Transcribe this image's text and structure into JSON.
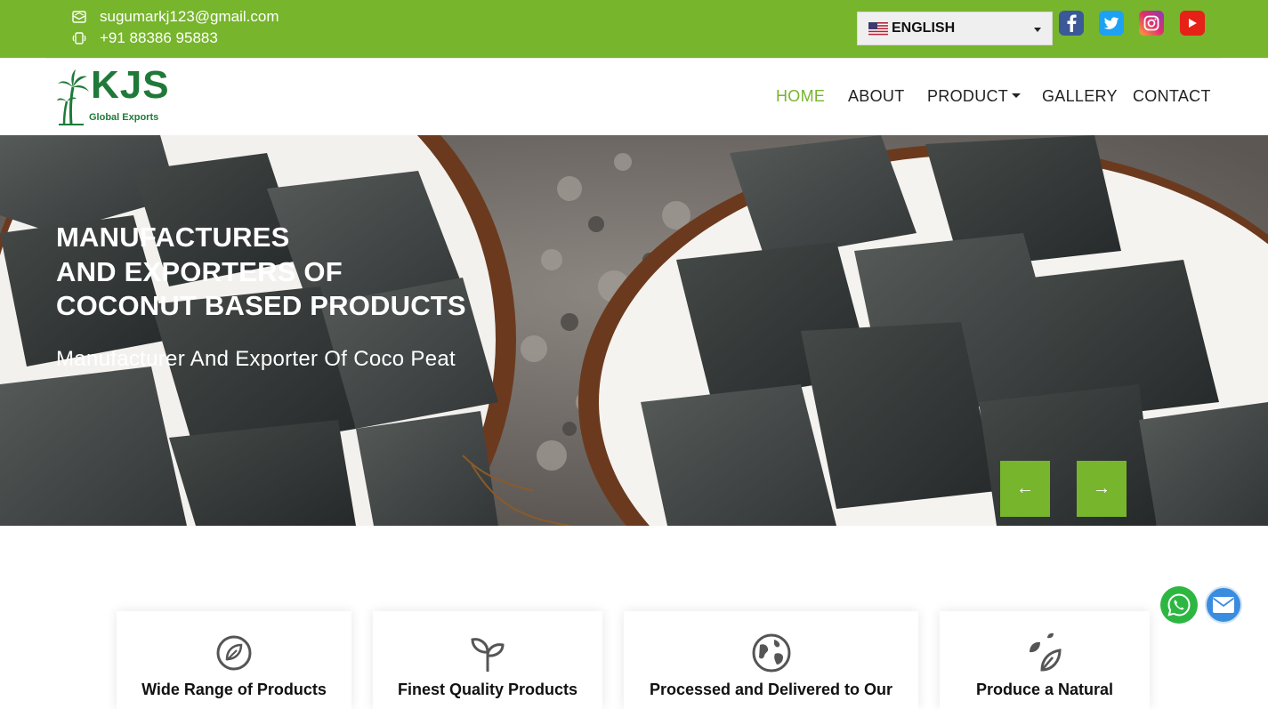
{
  "topbar": {
    "email": "sugumarkj123@gmail.com",
    "phone": "+91 88386 95883",
    "language": "ENGLISH",
    "social": [
      "facebook-icon",
      "twitter-icon",
      "instagram-icon",
      "youtube-icon"
    ]
  },
  "brand": {
    "name": "KJS",
    "tagline": "Global Exports"
  },
  "nav": {
    "items": [
      {
        "label": "HOME",
        "active": true
      },
      {
        "label": "ABOUT"
      },
      {
        "label": "PRODUCT",
        "dropdown": true
      },
      {
        "label": "GALLERY"
      },
      {
        "label": "CONTACT"
      }
    ]
  },
  "hero": {
    "title_lines": [
      "MANUFACTURES",
      "AND EXPORTERS OF",
      "COCONUT BASED PRODUCTS"
    ],
    "subtitle": "Manufacturer And Exporter Of Coco Peat",
    "prev_label": "←",
    "next_label": "→"
  },
  "features": [
    {
      "title": "Wide Range of Products",
      "icon": "leaf-icon"
    },
    {
      "title": "Finest Quality Products",
      "icon": "sprout-icon"
    },
    {
      "title": "Processed and Delivered to Our",
      "icon": "globe-icon"
    },
    {
      "title": "Produce a Natural",
      "icon": "eco-leaves-icon"
    }
  ],
  "colors": {
    "accent": "#77b52c",
    "brand_green": "#1f7a3a",
    "text": "#222222"
  }
}
